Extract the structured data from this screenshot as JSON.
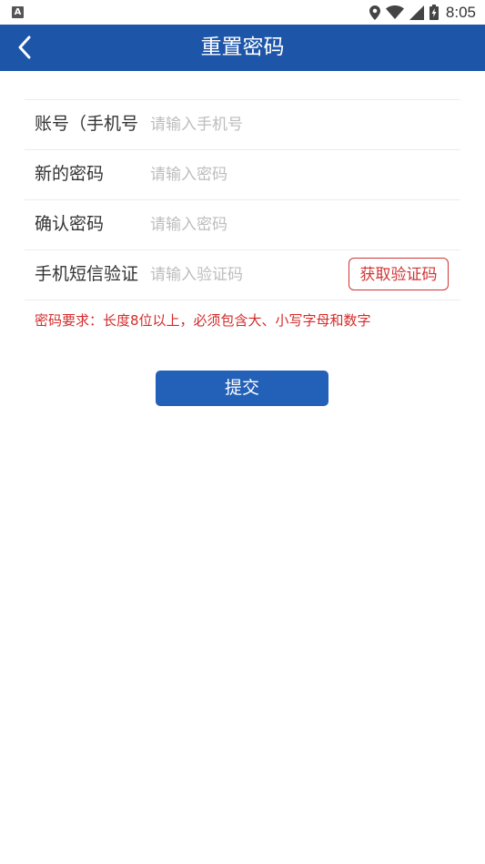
{
  "status_bar": {
    "left_icon_letter": "A",
    "time": "8:05",
    "icons": [
      "location-icon",
      "wifi-icon",
      "signal-icon",
      "battery-icon"
    ]
  },
  "header": {
    "title": "重置密码",
    "back_icon": "chevron-left-icon",
    "background_color": "#1d56a8"
  },
  "form": {
    "rows": [
      {
        "label": "账号（手机号",
        "placeholder": "请输入手机号",
        "value": ""
      },
      {
        "label": "新的密码",
        "placeholder": "请输入密码",
        "value": ""
      },
      {
        "label": "确认密码",
        "placeholder": "请输入密码",
        "value": ""
      },
      {
        "label": "手机短信验证",
        "placeholder": "请输入验证码",
        "value": ""
      }
    ],
    "get_code_label": "获取验证码"
  },
  "requirement_note": "密码要求：长度8位以上，必须包含大、小写字母和数字",
  "submit_label": "提交",
  "colors": {
    "accent": "#2360b8",
    "warning": "#d42a2a"
  }
}
